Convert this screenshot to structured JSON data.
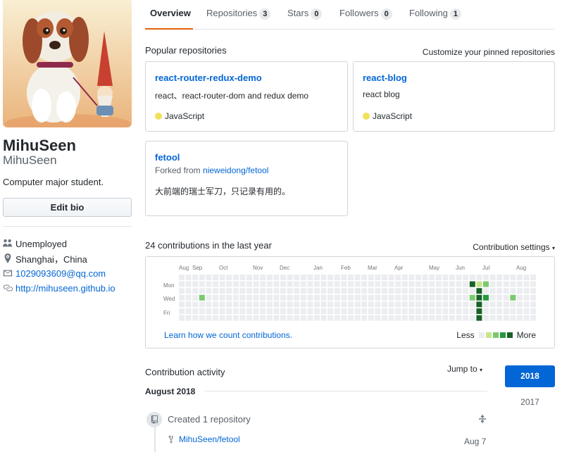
{
  "profile": {
    "fullname": "MihuSeen",
    "username": "MihuSeen",
    "bio": "Computer major student.",
    "edit_bio_label": "Edit bio",
    "details": [
      {
        "icon": "people-icon",
        "text": "Unemployed",
        "link": false
      },
      {
        "icon": "location-icon",
        "text": "Shanghai，China",
        "link": false
      },
      {
        "icon": "mail-icon",
        "text": "1029093609@qq.com",
        "link": true
      },
      {
        "icon": "link-icon",
        "text": "http://mihuseen.github.io",
        "link": true
      }
    ]
  },
  "tabs": [
    {
      "label": "Overview",
      "count": null,
      "selected": true
    },
    {
      "label": "Repositories",
      "count": "3",
      "selected": false
    },
    {
      "label": "Stars",
      "count": "0",
      "selected": false
    },
    {
      "label": "Followers",
      "count": "0",
      "selected": false
    },
    {
      "label": "Following",
      "count": "1",
      "selected": false
    }
  ],
  "pinned": {
    "title": "Popular repositories",
    "customize_label": "Customize your pinned repositories",
    "repos": [
      {
        "name": "react-router-redux-demo",
        "description": "react、react-router-dom and redux demo",
        "language": "JavaScript"
      },
      {
        "name": "react-blog",
        "description": "react blog",
        "language": "JavaScript"
      },
      {
        "name": "fetool",
        "forked_prefix": "Forked from",
        "forked_from": "nieweidong/fetool",
        "description": "大前端的瑞士军刀，只记录有用的。"
      }
    ],
    "lang_color": "#f1e05a"
  },
  "contributions": {
    "title": "24 contributions in the last year",
    "settings_label": "Contribution settings",
    "months": [
      "Aug",
      "Sep",
      "Oct",
      "Nov",
      "Dec",
      "Jan",
      "Feb",
      "Mar",
      "Apr",
      "May",
      "Jun",
      "Jul",
      "Aug"
    ],
    "days": [
      "Mon",
      "Wed",
      "Fri"
    ],
    "learn_link": "Learn how we count contributions.",
    "legend_less": "Less",
    "legend_more": "More",
    "level_colors": [
      "#ebedf0",
      "#c6e48b",
      "#7bc96f",
      "#239a3b",
      "#196127"
    ],
    "active_cells": [
      {
        "week": 3,
        "day": 3,
        "level": 2
      },
      {
        "week": 42,
        "day": 7,
        "level": 4
      },
      {
        "week": 43,
        "day": 1,
        "level": 4
      },
      {
        "week": 43,
        "day": 3,
        "level": 2
      },
      {
        "week": 44,
        "day": 1,
        "level": 1
      },
      {
        "week": 44,
        "day": 2,
        "level": 4
      },
      {
        "week": 44,
        "day": 3,
        "level": 4
      },
      {
        "week": 44,
        "day": 4,
        "level": 4
      },
      {
        "week": 44,
        "day": 5,
        "level": 4
      },
      {
        "week": 44,
        "day": 6,
        "level": 4
      },
      {
        "week": 45,
        "day": 1,
        "level": 2
      },
      {
        "week": 45,
        "day": 3,
        "level": 3
      },
      {
        "week": 49,
        "day": 3,
        "level": 2
      }
    ]
  },
  "activity": {
    "title": "Contribution activity",
    "jump_to": "Jump to",
    "years": [
      "2018",
      "2017"
    ],
    "month": "August 2018",
    "event": "Created 1 repository",
    "repo": "MihuSeen/fetool",
    "date": "Aug 7"
  }
}
